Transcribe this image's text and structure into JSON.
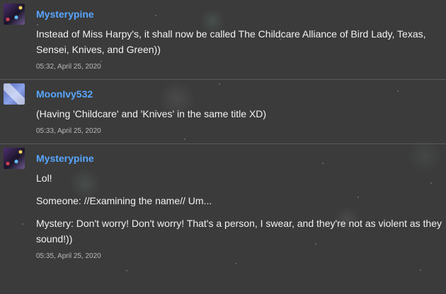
{
  "comments": [
    {
      "author": "Mysterypine",
      "avatar_icon": "purple-avatar-icon",
      "paragraphs": [
        "Instead of Miss Harpy's, it shall now be called The Childcare Alliance of Bird Lady, Texas, Sensei, Knives, and Green))"
      ],
      "time": "05:32, April 25, 2020"
    },
    {
      "author": "MoonIvy532",
      "avatar_icon": "diamond-avatar-icon",
      "paragraphs": [
        "(Having 'Childcare' and 'Knives' in the same title XD)"
      ],
      "time": "05:33, April 25, 2020"
    },
    {
      "author": "Mysterypine",
      "avatar_icon": "purple-avatar-icon",
      "paragraphs": [
        "Lol!",
        "Someone: //Examining the name// Um...",
        "Mystery: Don't worry! Don't worry! That's a person, I swear, and they're not as violent as they sound!))"
      ],
      "time": "05:35, April 25, 2020"
    }
  ]
}
